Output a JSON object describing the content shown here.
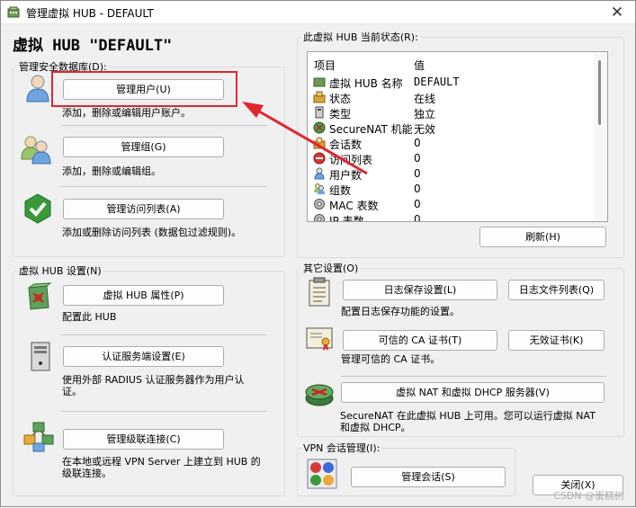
{
  "window": {
    "title": "管理虚拟 HUB - DEFAULT",
    "close_glyph": "✕",
    "heading": "虚拟 HUB \"DEFAULT\""
  },
  "security_db": {
    "legend": "管理安全数据库(D):",
    "manage_users": {
      "label": "管理用户(U)",
      "desc": "添加，删除或编辑用户账户。",
      "icon": "user-icon"
    },
    "manage_groups": {
      "label": "管理组(G)",
      "desc": "添加，删除或编辑组。",
      "icon": "group-icon"
    },
    "manage_access_list": {
      "label": "管理访问列表(A)",
      "desc": "添加或删除访问列表 (数据包过滤规则)。",
      "icon": "checkmark-shield-icon"
    }
  },
  "hub_settings": {
    "legend": "虚拟 HUB 设置(N)",
    "properties": {
      "label": "虚拟 HUB 属性(P)",
      "desc": "配置此 HUB",
      "icon": "hub-properties-icon"
    },
    "auth_server": {
      "label": "认证服务端设置(E)",
      "desc": "使用外部 RADIUS 认证服务器作为用户认证。",
      "icon": "server-icon"
    },
    "cascade": {
      "label": "管理级联连接(C)",
      "desc": "在本地或远程 VPN Server 上建立到 HUB 的级联连接。",
      "icon": "cascade-network-icon"
    }
  },
  "status": {
    "legend": "此虚拟 HUB 当前状态(R):",
    "headers": {
      "item": "项目",
      "value": "值"
    },
    "rows": [
      {
        "icon": "hub-icon",
        "item": "虚拟 HUB 名称",
        "value": "DEFAULT"
      },
      {
        "icon": "status-icon",
        "item": "状态",
        "value": "在线"
      },
      {
        "icon": "type-icon",
        "item": "类型",
        "value": "独立"
      },
      {
        "icon": "securenat-icon",
        "item": "SecureNAT 机能",
        "value": "无效"
      },
      {
        "icon": "session-icon",
        "item": "会话数",
        "value": "0"
      },
      {
        "icon": "access-list-icon",
        "item": "访问列表",
        "value": "0"
      },
      {
        "icon": "user-icon",
        "item": "用户数",
        "value": "0"
      },
      {
        "icon": "group-icon",
        "item": "组数",
        "value": "0"
      },
      {
        "icon": "mac-table-icon",
        "item": "MAC 表数",
        "value": "0"
      },
      {
        "icon": "ip-table-icon",
        "item": "IP 表数",
        "value": "0"
      }
    ],
    "refresh_label": "刷新(H)"
  },
  "other": {
    "legend": "其它设置(O)",
    "log_settings": {
      "label": "日志保存设置(L)",
      "desc": "配置日志保存功能的设置。",
      "icon": "log-document-icon"
    },
    "log_files": {
      "label": "日志文件列表(Q)"
    },
    "trusted_ca": {
      "label": "可信的 CA 证书(T)",
      "desc": "管理可信的 CA 证书。",
      "icon": "certificate-icon"
    },
    "invalid_cert": {
      "label": "无效证书(K)"
    },
    "nat_dhcp": {
      "label": "虚拟 NAT 和虚拟 DHCP 服务器(V)",
      "desc": "SecureNAT 在此虚拟 HUB 上可用。您可以运行虚拟 NAT 和虚拟 DHCP。",
      "icon": "nat-router-icon"
    }
  },
  "vpn_sessions": {
    "legend": "VPN 会话管理(I):",
    "manage_sessions": {
      "label": "管理会话(S)",
      "icon": "sessions-grid-icon"
    }
  },
  "close_label": "关闭(X)",
  "watermark": "CSDN @蛋糕树",
  "colors": {
    "highlight_border": "#e0262e",
    "arrow": "#e0262e",
    "window_bg": "#f0f0f0"
  }
}
